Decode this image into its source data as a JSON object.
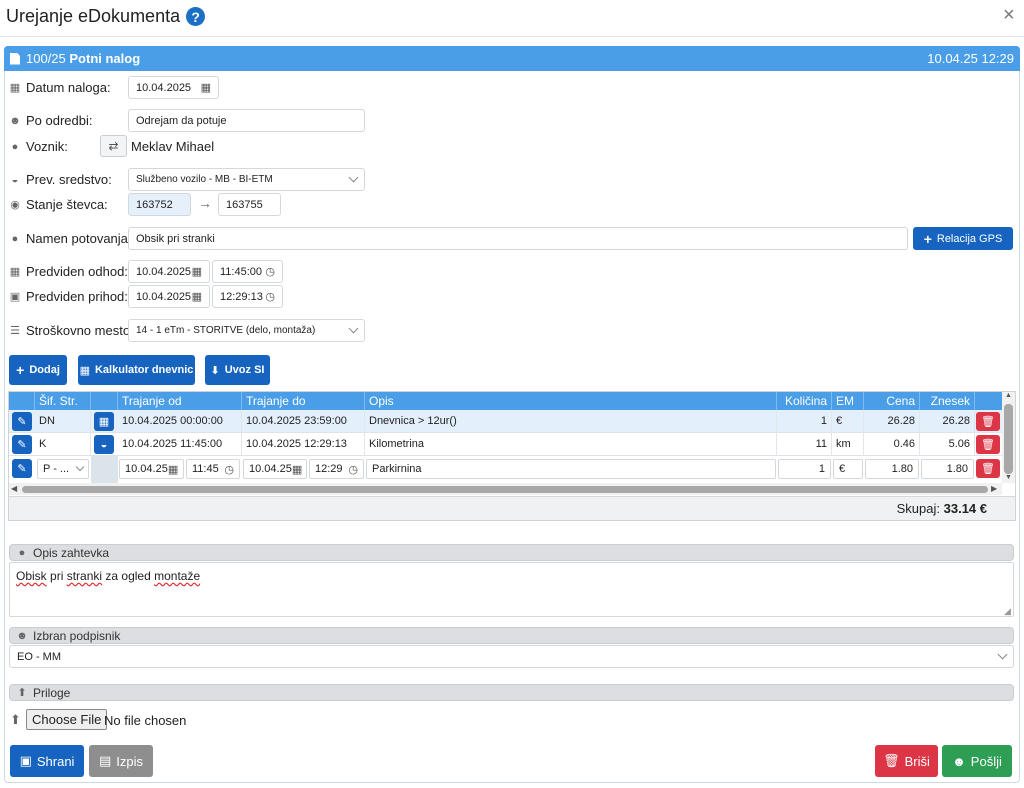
{
  "dialog": {
    "title": "Urejanje eDokumenta",
    "help": "?",
    "close": "×"
  },
  "panel": {
    "number": "100/25",
    "type": "Potni nalog",
    "datetime": "10.04.25 12:29"
  },
  "form": {
    "datum_label": "Datum naloga:",
    "datum_value": "10.04.2025",
    "odredbi_label": "Po odredbi:",
    "odredbi_value": "Odrejam da potuje",
    "voznik_label": "Voznik:",
    "voznik_value": "Meklav Mihael",
    "prev_label": "Prev. sredstvo:",
    "prev_value": "Službeno vozilo - MB - BI-ETM",
    "stevec_label": "Stanje števca:",
    "stevec_from": "163752",
    "stevec_to": "163755",
    "namen_label": "Namen potovanja:",
    "namen_value": "Obsik pri stranki",
    "relacija_btn": "Relacija GPS",
    "odhod_label": "Predviden odhod:",
    "odhod_date": "10.04.2025",
    "odhod_time": "11:45:00",
    "prihod_label": "Predviden prihod:",
    "prihod_date": "10.04.2025",
    "prihod_time": "12:29:13",
    "strosek_label": "Stroškovno mesto:",
    "strosek_value": "14 - 1 eTm - STORITVE (delo, montaža)"
  },
  "actions": {
    "dodaj": "Dodaj",
    "kalkulator": "Kalkulator dnevnic",
    "uvoz": "Uvoz SI"
  },
  "table": {
    "headers": {
      "sif": "Šif. Str.",
      "od": "Trajanje od",
      "do": "Trajanje do",
      "opis": "Opis",
      "kolicina": "Količina",
      "em": "EM",
      "cena": "Cena",
      "znesek": "Znesek"
    },
    "rows": [
      {
        "sif": "DN",
        "od": "10.04.2025 00:00:00",
        "do": "10.04.2025 23:59:00",
        "opis": "Dnevnica > 12ur()",
        "kolicina": "1",
        "em": "€",
        "cena": "26.28",
        "znesek": "26.28"
      },
      {
        "sif": "K",
        "od": "10.04.2025 11:45:00",
        "do": "10.04.2025 12:29:13",
        "opis": "Kilometrina",
        "kolicina": "11",
        "em": "km",
        "cena": "0.46",
        "znesek": "5.06"
      },
      {
        "sif": "P - ...",
        "od_date": "10.04.25",
        "od_time": "11:45",
        "do_date": "10.04.25",
        "do_time": "12:29",
        "opis": "Parkirnina",
        "kolicina": "1",
        "em": "€",
        "cena": "1.80",
        "znesek": "1.80"
      }
    ],
    "total_label": "Skupaj:",
    "total_value": "33.14 €"
  },
  "opis": {
    "header": "Opis zahtevka",
    "text_1": "Obisk",
    "text_2": " pri ",
    "text_3": "stranki",
    "text_4": " za ogled ",
    "text_5": "montaže"
  },
  "podpisnik": {
    "header": "Izbran podpisnik",
    "value": "EO - MM"
  },
  "priloge": {
    "header": "Priloge",
    "file_btn": "Choose File",
    "file_status": "No file chosen"
  },
  "footer": {
    "shrani": "Shrani",
    "izpis": "Izpis",
    "brisi": "Briši",
    "poslji": "Pošlji"
  }
}
